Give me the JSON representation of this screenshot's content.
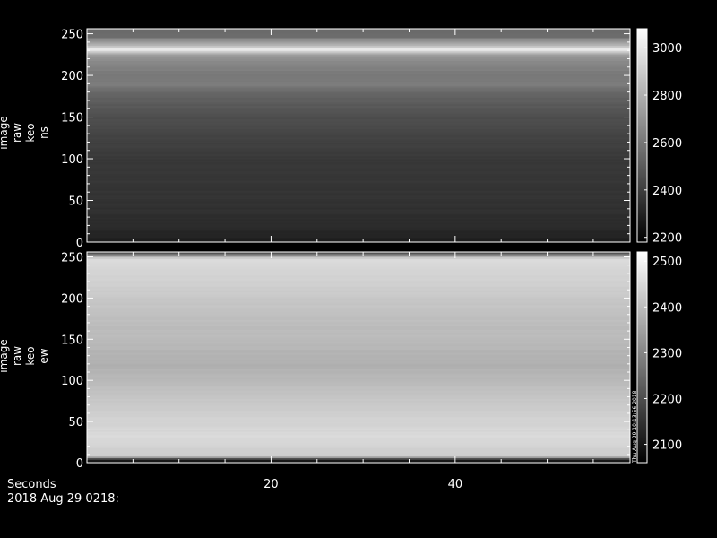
{
  "chart_data": [
    {
      "type": "heatmap",
      "ylabel_lines": [
        "image",
        "raw",
        "keo",
        "ns"
      ],
      "xlim": [
        0,
        59
      ],
      "ylim": [
        0,
        256
      ],
      "y_ticks": [
        0,
        50,
        100,
        150,
        200,
        250
      ],
      "x_ticks": [
        20,
        40
      ],
      "colorbar": {
        "min": 2180,
        "max": 3080,
        "ticks": [
          2200,
          2400,
          2600,
          2800,
          3000
        ]
      },
      "row_profile": [
        [
          0,
          2240
        ],
        [
          5,
          2260
        ],
        [
          20,
          2300
        ],
        [
          50,
          2330
        ],
        [
          100,
          2350
        ],
        [
          130,
          2400
        ],
        [
          150,
          2430
        ],
        [
          165,
          2470
        ],
        [
          180,
          2520
        ],
        [
          190,
          2600
        ],
        [
          200,
          2580
        ],
        [
          210,
          2620
        ],
        [
          218,
          2650
        ],
        [
          225,
          2720
        ],
        [
          232,
          3050
        ],
        [
          236,
          2820
        ],
        [
          241,
          2700
        ],
        [
          247,
          2550
        ],
        [
          256,
          2520
        ]
      ]
    },
    {
      "type": "heatmap",
      "ylabel_lines": [
        "image",
        "raw",
        "keo",
        "ew"
      ],
      "xlim": [
        0,
        59
      ],
      "ylim": [
        0,
        256
      ],
      "y_ticks": [
        0,
        50,
        100,
        150,
        200,
        250
      ],
      "x_ticks": [
        20,
        40
      ],
      "colorbar": {
        "min": 2060,
        "max": 2520,
        "ticks": [
          2100,
          2200,
          2300,
          2400,
          2500
        ]
      },
      "row_profile": [
        [
          0,
          2080
        ],
        [
          4,
          2090
        ],
        [
          8,
          2420
        ],
        [
          30,
          2450
        ],
        [
          60,
          2430
        ],
        [
          100,
          2390
        ],
        [
          120,
          2370
        ],
        [
          150,
          2390
        ],
        [
          180,
          2400
        ],
        [
          230,
          2440
        ],
        [
          248,
          2450
        ],
        [
          252,
          2350
        ],
        [
          256,
          2150
        ]
      ]
    }
  ],
  "footer": {
    "xaxis_label": "Seconds",
    "date_label": "2018 Aug 29 0218:"
  },
  "stamp": "Thu Aug 29 10:13:56 2018"
}
